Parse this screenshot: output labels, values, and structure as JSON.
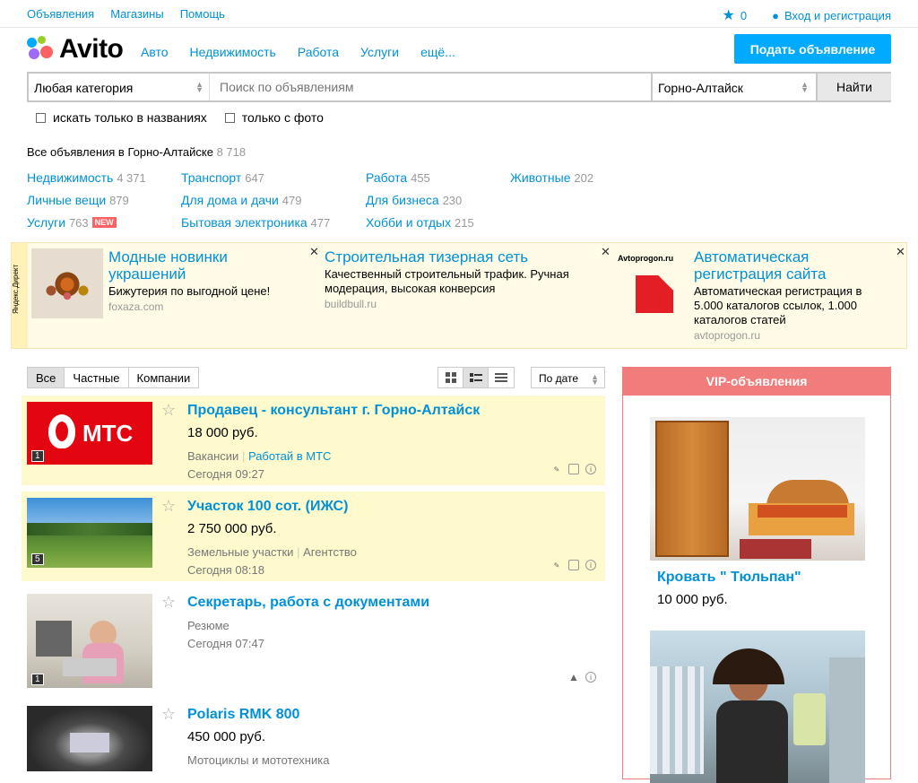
{
  "topbar": {
    "links": [
      "Объявления",
      "Магазины",
      "Помощь"
    ],
    "favorites_count": "0",
    "login": "Вход и регистрация"
  },
  "header": {
    "logo": "Avito",
    "nav": [
      "Авто",
      "Недвижимость",
      "Работа",
      "Услуги",
      "ещё..."
    ],
    "post_button": "Подать объявление"
  },
  "search": {
    "category": "Любая категория",
    "placeholder": "Поиск по объявлениям",
    "city": "Горно-Алтайск",
    "button": "Найти",
    "filters": [
      "искать только в названиях",
      "только с фото"
    ]
  },
  "summary": {
    "label": "Все объявления в Горно-Алтайске",
    "count": "8 718"
  },
  "categories": [
    {
      "name": "Недвижимость",
      "count": "4 371"
    },
    {
      "name": "Личные вещи",
      "count": "879"
    },
    {
      "name": "Услуги",
      "count": "763",
      "badge": "NEW"
    },
    {
      "name": "Транспорт",
      "count": "647"
    },
    {
      "name": "Для дома и дачи",
      "count": "479"
    },
    {
      "name": "Бытовая электроника",
      "count": "477"
    },
    {
      "name": "Работа",
      "count": "455"
    },
    {
      "name": "Для бизнеса",
      "count": "230"
    },
    {
      "name": "Хобби и отдых",
      "count": "215"
    },
    {
      "name": "Животные",
      "count": "202"
    }
  ],
  "ads": {
    "label": "Яндекс.Директ",
    "items": [
      {
        "title": "Модные новинки украшений",
        "desc": "Бижутерия по выгодной цене!",
        "url": "foxaza.com"
      },
      {
        "title": "Строительная тизерная сеть",
        "desc": "Качественный строительный трафик. Ручная модерация, высокая конверсия",
        "url": "buildbull.ru"
      },
      {
        "title": "Автоматическая регистрация сайта",
        "desc": "Автоматическая регистрация в 5.000 каталогов ссылок, 1.000 каталогов статей",
        "url": "avtoprogon.ru",
        "logo": "Avtoprogon.ru"
      }
    ]
  },
  "listing": {
    "tabs": [
      "Все",
      "Частные",
      "Компании"
    ],
    "sort": "По дате",
    "items": [
      {
        "title": "Продавец - консультант г. Горно-Алтайск",
        "price": "18 000 руб.",
        "category": "Вакансии",
        "seller": "Работай в МТС",
        "date": "Сегодня 09:27",
        "photos": "1",
        "thumb_text": "МТС"
      },
      {
        "title": "Участок 100 сот. (ИЖС)",
        "price": "2 750 000 руб.",
        "category": "Земельные участки",
        "seller": "Агентство",
        "date": "Сегодня 08:18",
        "photos": "5"
      },
      {
        "title": "Секретарь, работа с документами",
        "category": "Резюме",
        "date": "Сегодня 07:47",
        "photos": "1"
      },
      {
        "title": "Polaris RMK 800",
        "price": "450 000 руб.",
        "category": "Мотоциклы и мототехника"
      }
    ]
  },
  "vip": {
    "header": "VIP-объявления",
    "items": [
      {
        "title": "Кровать \" Тюльпан\"",
        "price": "10 000 руб."
      }
    ]
  }
}
